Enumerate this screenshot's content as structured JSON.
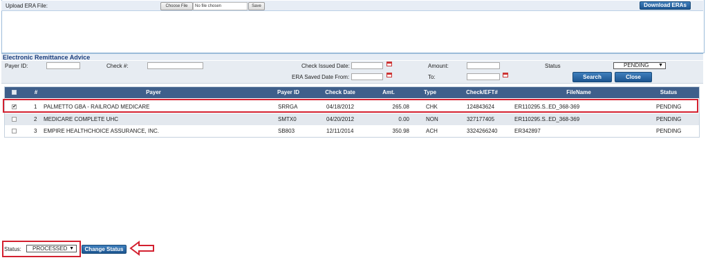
{
  "upload": {
    "label": "Upload ERA File:",
    "choose_file_label": "Choose File",
    "file_status": "No file chosen",
    "save_label": "Save",
    "download_label": "Download ERAs"
  },
  "era": {
    "title": "Electronic Remittance Advice",
    "filters": {
      "payer_id_label": "Payer ID:",
      "check_no_label": "Check #:",
      "check_issued_label": "Check Issued Date:",
      "amount_label": "Amount:",
      "status_label": "Status",
      "status_value": "PENDING",
      "era_saved_from_label": "ERA Saved Date From:",
      "to_label": "To:",
      "search_label": "Search",
      "close_label": "Close"
    },
    "columns": [
      "#",
      "Payer",
      "Payer ID",
      "Check Date",
      "Amt.",
      "Type",
      "Check/EFT#",
      "FileName",
      "Status"
    ],
    "rows": [
      {
        "checked": true,
        "num": "1",
        "payer": "PALMETTO GBA - RAILROAD MEDICARE",
        "payer_id": "SRRGA",
        "check_date": "04/18/2012",
        "amt": "265.08",
        "type": "CHK",
        "check_eft": "124843624",
        "filename": "ER110295.S..ED_368-369",
        "status": "PENDING"
      },
      {
        "checked": false,
        "num": "2",
        "payer": "MEDICARE COMPLETE UHC",
        "payer_id": "SMTX0",
        "check_date": "04/20/2012",
        "amt": "0.00",
        "type": "NON",
        "check_eft": "327177405",
        "filename": "ER110295.S..ED_368-369",
        "status": "PENDING"
      },
      {
        "checked": false,
        "num": "3",
        "payer": "EMPIRE HEALTHCHOICE ASSURANCE, INC.",
        "payer_id": "SB803",
        "check_date": "12/11/2014",
        "amt": "350.98",
        "type": "ACH",
        "check_eft": "3324266240",
        "filename": "ER342897",
        "status": "PENDING"
      }
    ]
  },
  "bottom": {
    "status_label": "Status:",
    "status_value": "PROCESSED",
    "change_status_label": "Change Status"
  },
  "colors": {
    "header_blue": "#3f5f8b",
    "button_blue": "#1c5590",
    "highlight_red": "#d3202f"
  }
}
